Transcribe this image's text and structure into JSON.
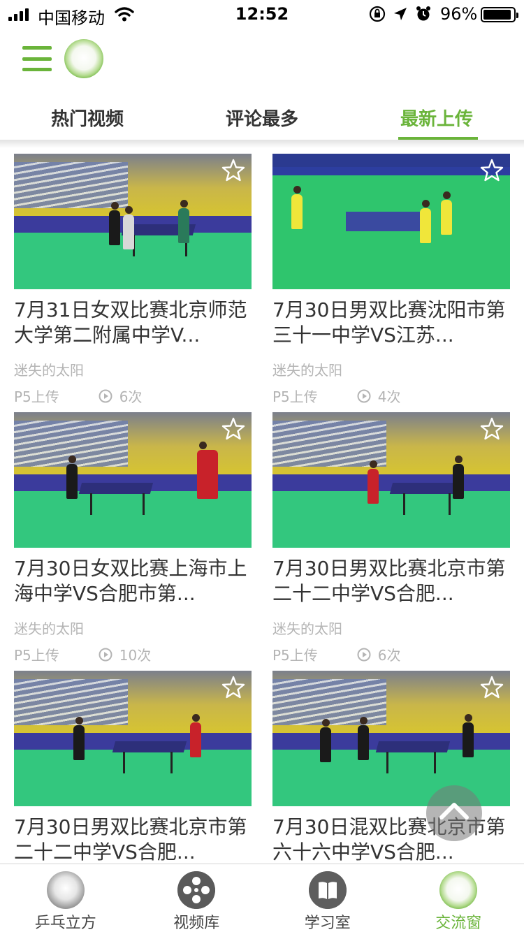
{
  "status_bar": {
    "carrier": "中国移动",
    "time": "12:52",
    "battery": "96%",
    "icons": [
      "signal-icon",
      "wifi-icon",
      "orientation-lock-icon",
      "location-arrow-icon",
      "alarm-icon",
      "battery-icon"
    ]
  },
  "header": {
    "menu_icon": "hamburger-menu-icon",
    "logo_icon": "green-ring-logo"
  },
  "tabs": [
    {
      "label": "热门视频",
      "active": false
    },
    {
      "label": "评论最多",
      "active": false
    },
    {
      "label": "最新上传",
      "active": true
    }
  ],
  "videos": [
    {
      "title": "7月31日女双比赛北京师范大学第二附属中学V...",
      "author": "迷失的太阳",
      "uploader": "P5上传",
      "views": "6次"
    },
    {
      "title": "7月30日男双比赛沈阳市第三十一中学VS江苏...",
      "author": "迷失的太阳",
      "uploader": "P5上传",
      "views": "4次"
    },
    {
      "title": "7月30日女双比赛上海市上海中学VS合肥市第...",
      "author": "迷失的太阳",
      "uploader": "P5上传",
      "views": "10次"
    },
    {
      "title": "7月30日男双比赛北京市第二十二中学VS合肥...",
      "author": "迷失的太阳",
      "uploader": "P5上传",
      "views": "6次"
    },
    {
      "title": "7月30日男双比赛北京市第二十二中学VS合肥...",
      "author": "",
      "uploader": "",
      "views": ""
    },
    {
      "title": "7月30日混双比赛北京市第六十六中学VS合肥...",
      "author": "",
      "uploader": "",
      "views": ""
    }
  ],
  "tabbar": [
    {
      "label": "乒乓立方",
      "icon": "pingpong-ball-icon",
      "active": false
    },
    {
      "label": "视频库",
      "icon": "film-reel-icon",
      "active": false
    },
    {
      "label": "学习室",
      "icon": "book-icon",
      "active": false
    },
    {
      "label": "交流窗",
      "icon": "green-ring-icon",
      "active": true
    }
  ],
  "colors": {
    "accent": "#6ab43a",
    "muted_text": "#b4b4b4",
    "title_text": "#333333"
  }
}
